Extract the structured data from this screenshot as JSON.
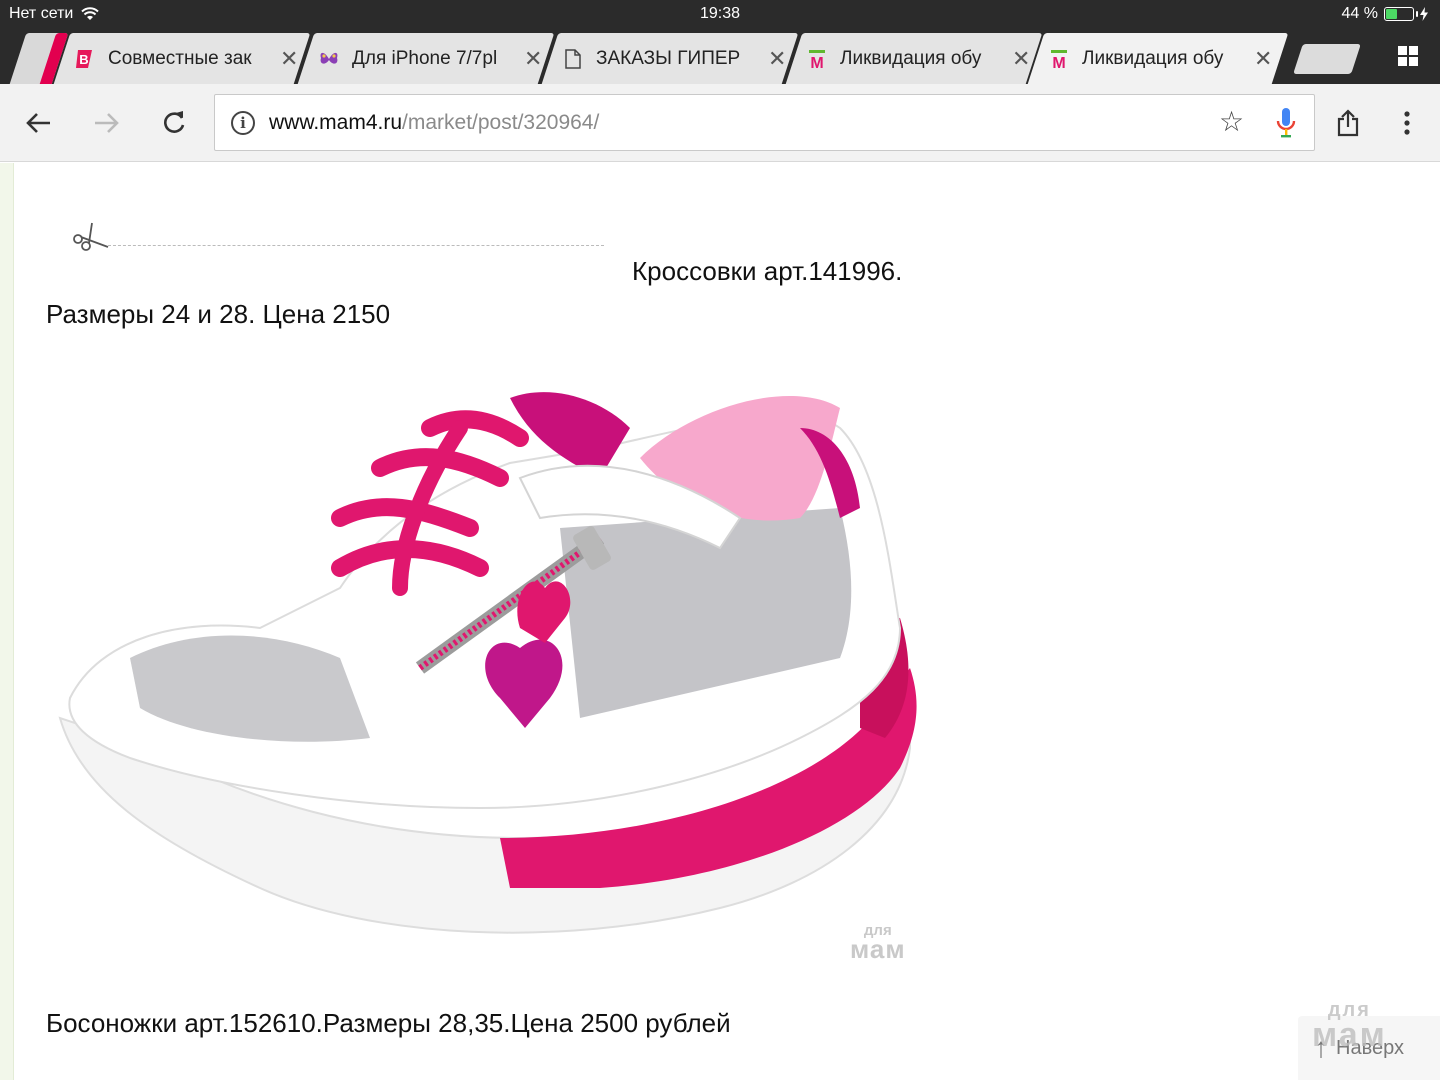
{
  "status_bar": {
    "carrier": "Нет сети",
    "time": "19:38",
    "battery": "44 %",
    "battery_level": 0.44
  },
  "tabs": [
    {
      "title": "Совместные зак",
      "favicon": "b-logo-icon",
      "active": false
    },
    {
      "title": "Для iPhone 7/7pl",
      "favicon": "butterfly-icon",
      "active": false
    },
    {
      "title": "ЗАКАЗЫ ГИПЕР",
      "favicon": "document-icon",
      "active": false
    },
    {
      "title": "Ликвидация обу",
      "favicon": "mam4-logo-icon",
      "active": false
    },
    {
      "title": "Ликвидация обу",
      "favicon": "mam4-logo-icon",
      "active": true
    }
  ],
  "toolbar": {
    "url_domain": "www.mam4.ru",
    "url_path": "/market/post/320964/"
  },
  "content": {
    "item1_title": "Кроссовки арт.141996.",
    "item1_details": "Размеры 24 и 28. Цена 2150",
    "watermark_top": "для",
    "watermark_bottom": "мам",
    "item2_title": "Босоножки арт.152610.Размеры 28,35.Цена 2500 рублей",
    "back_to_top": "Наверх"
  },
  "colors": {
    "accent_pink": "#e0176e",
    "status_bar_bg": "#2b2b2b",
    "toolbar_bg": "#f2f2f2"
  }
}
